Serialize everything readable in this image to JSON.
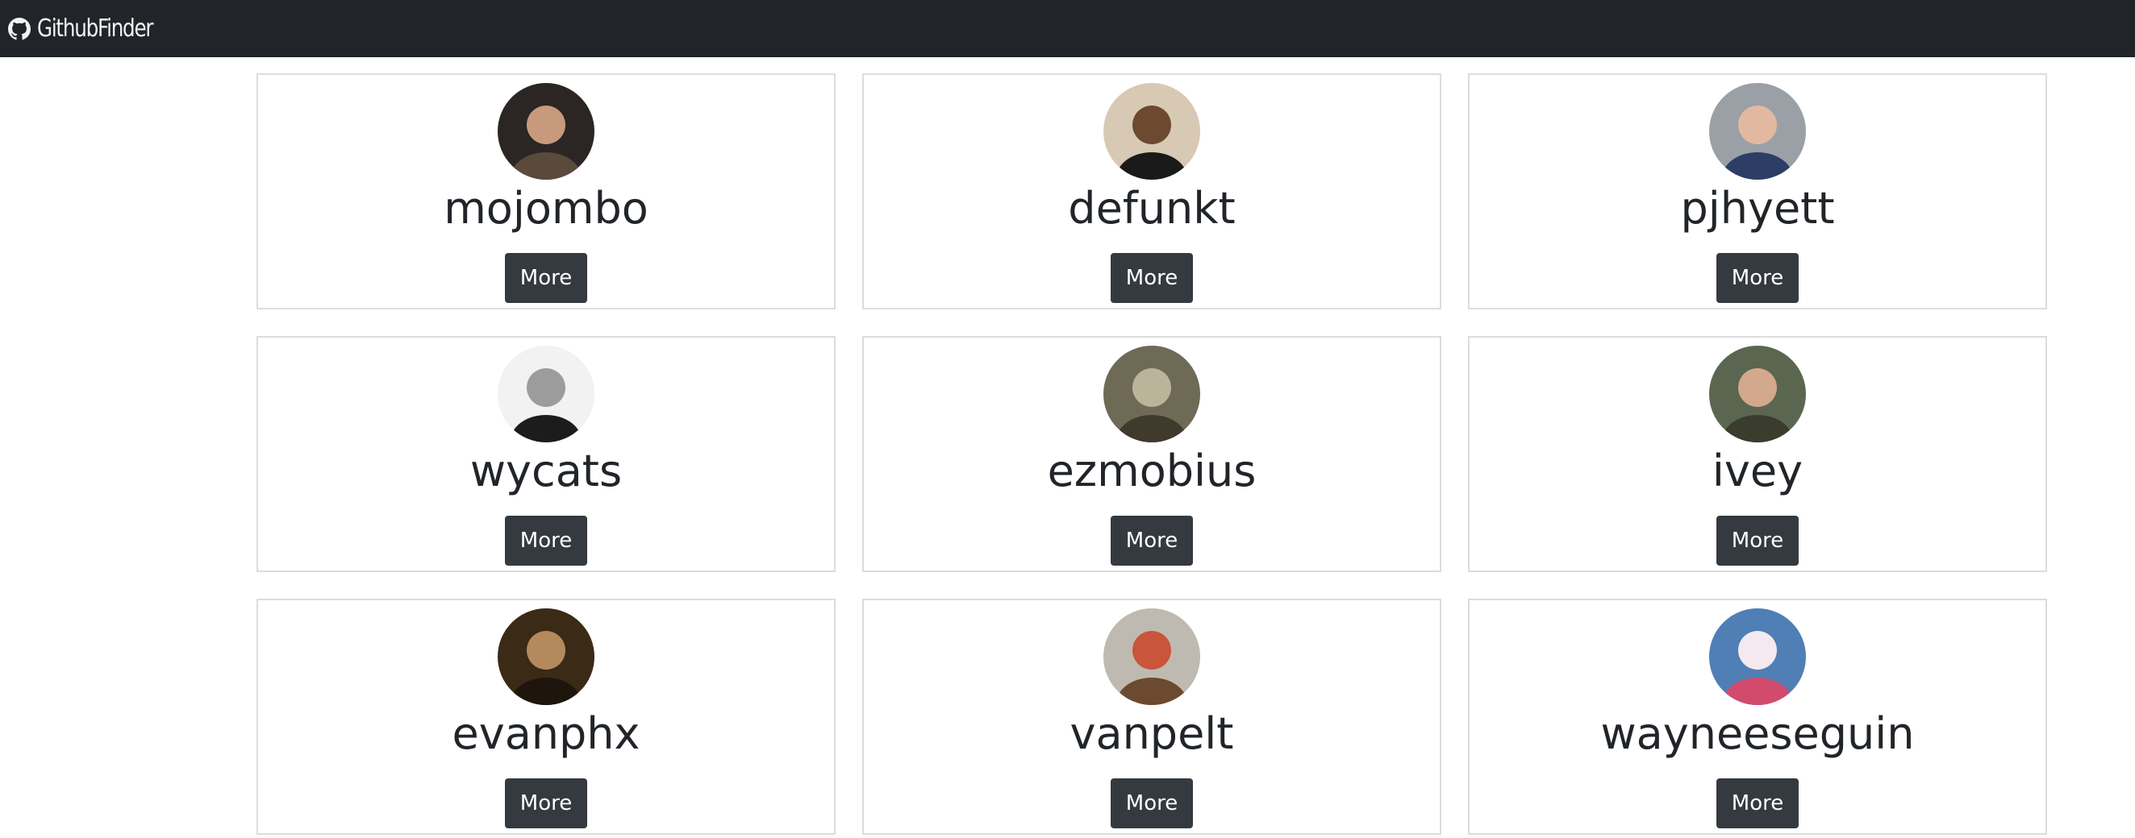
{
  "navbar": {
    "brand_icon": "github-icon",
    "title": "GithubFinder"
  },
  "users": [
    {
      "login": "mojombo",
      "button_label": "More",
      "avatar_colors": [
        "#2b2623",
        "#c79a7e",
        "#5a4a3c"
      ]
    },
    {
      "login": "defunkt",
      "button_label": "More",
      "avatar_colors": [
        "#d8c9b5",
        "#6b4a2f",
        "#1a1a1a"
      ]
    },
    {
      "login": "pjhyett",
      "button_label": "More",
      "avatar_colors": [
        "#9aa0a6",
        "#e2b9a0",
        "#2c3e66"
      ]
    },
    {
      "login": "wycats",
      "button_label": "More",
      "avatar_colors": [
        "#f2f2f2",
        "#9c9c9c",
        "#1c1c1c"
      ]
    },
    {
      "login": "ezmobius",
      "button_label": "More",
      "avatar_colors": [
        "#6f6a55",
        "#b9b49a",
        "#3f3a2c"
      ]
    },
    {
      "login": "ivey",
      "button_label": "More",
      "avatar_colors": [
        "#5b6650",
        "#d4a88c",
        "#3a3c2e"
      ]
    },
    {
      "login": "evanphx",
      "button_label": "More",
      "avatar_colors": [
        "#3a2a16",
        "#b48a5c",
        "#1e160c"
      ]
    },
    {
      "login": "vanpelt",
      "button_label": "More",
      "avatar_colors": [
        "#bfbab1",
        "#c9553a",
        "#6b4a2f"
      ]
    },
    {
      "login": "wayneeseguin",
      "button_label": "More",
      "avatar_colors": [
        "#4f7fb5",
        "#f3e9ef",
        "#d24b6c"
      ]
    }
  ]
}
